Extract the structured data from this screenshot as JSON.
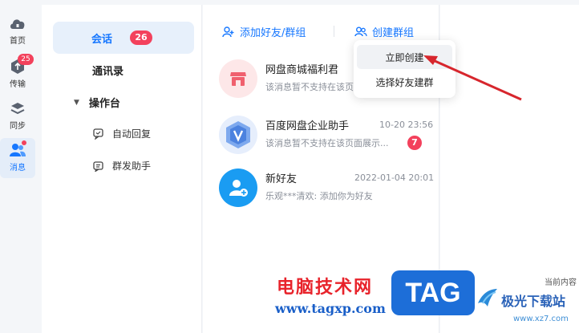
{
  "rail": {
    "items": [
      {
        "label": "首页",
        "icon": "cloud-home-icon"
      },
      {
        "label": "传输",
        "icon": "transfer-icon",
        "badge": "25"
      },
      {
        "label": "同步",
        "icon": "sync-icon"
      },
      {
        "label": "消息",
        "icon": "contacts-icon",
        "active": true,
        "dot": true
      }
    ]
  },
  "nav": {
    "sessions_label": "会话",
    "sessions_badge": "26",
    "contacts_label": "通讯录",
    "console_label": "操作台",
    "auto_reply_label": "自动回复",
    "broadcast_label": "群发助手"
  },
  "list": {
    "add_friend_label": "添加好友/群组",
    "create_group_label": "创建群组",
    "conversations": [
      {
        "name": "网盘商城福利君",
        "time": "",
        "preview": "该消息暂不支持在该页面展示...",
        "badge": "",
        "avatar": "shop-avatar"
      },
      {
        "name": "百度网盘企业助手",
        "time": "10-20 23:56",
        "preview": "该消息暂不支持在该页面展示...",
        "badge": "7",
        "avatar": "enterprise-avatar"
      },
      {
        "name": "新好友",
        "time": "2022-01-04 20:01",
        "preview": "乐观***清欢: 添加你为好友",
        "badge": "",
        "avatar": "new-friend-avatar"
      }
    ]
  },
  "dropdown": {
    "items": [
      "立即创建",
      "选择好友建群"
    ]
  },
  "right": {
    "note": "当前内容"
  },
  "watermark": {
    "site_cn": "电脑技术网",
    "site_url": "www.tagxp.com",
    "tag": "TAG",
    "brand_cn": "极光下载站",
    "brand_url": "www.xz7.com"
  },
  "colors": {
    "accent": "#1677ff",
    "badge": "#f3415c",
    "arrow": "#d7262d"
  }
}
